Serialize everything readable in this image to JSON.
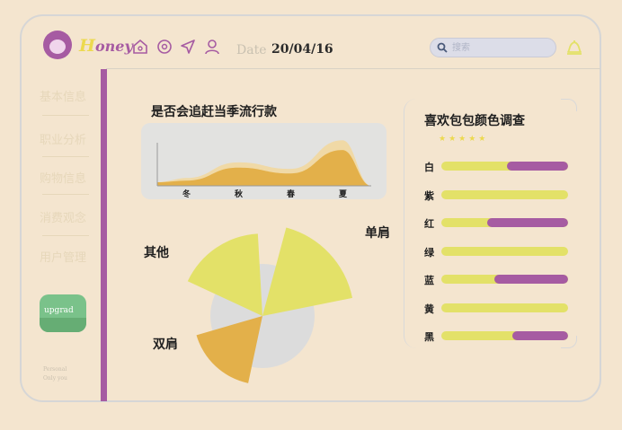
{
  "brand": {
    "first": "H",
    "rest": "oney"
  },
  "header": {
    "date_label": "Date",
    "date_value": "20/04/16",
    "search_placeholder": "搜索"
  },
  "sidebar": {
    "items": [
      {
        "label": "基本信息"
      },
      {
        "label": "职业分析"
      },
      {
        "label": "购物信息"
      },
      {
        "label": "消费观念"
      },
      {
        "label": "用户管理"
      }
    ],
    "upgrade_label": "upgrad",
    "footnote": [
      "Personal",
      "Only you"
    ]
  },
  "trend": {
    "title": "是否会追赶当季流行款",
    "chart_data": {
      "type": "area",
      "title": "是否会追赶当季流行款",
      "categories": [
        "冬",
        "秋",
        "春",
        "夏"
      ],
      "series": [
        {
          "values": [
            1.2,
            3.6,
            2.6,
            7.0
          ]
        },
        {
          "values": [
            0.8,
            2.8,
            1.9,
            5.5
          ]
        }
      ],
      "ylim": [
        0,
        8
      ],
      "colors": [
        "#f0d9a6",
        "#e3b04a"
      ]
    }
  },
  "bag_type": {
    "chart_data": {
      "type": "pie",
      "categories": [
        "单肩",
        "其他",
        "双肩"
      ],
      "values": [
        34,
        33,
        33
      ],
      "radius_share": [
        1.0,
        0.9,
        0.75
      ],
      "colors": [
        "#e3e168",
        "#e3e168",
        "#e3b04a"
      ],
      "base_color": "#dcdcdc"
    }
  },
  "color_survey": {
    "title": "喜欢包包颜色调查",
    "stars": "★★★★★",
    "chart_data": {
      "type": "bar",
      "categories": [
        "白",
        "紫",
        "红",
        "绿",
        "蓝",
        "黄",
        "黑"
      ],
      "values": [
        0.48,
        0.0,
        0.64,
        0.0,
        0.58,
        0.0,
        0.44
      ],
      "colors": {
        "track": "#e3e168",
        "fill": "#a65ba2"
      }
    }
  },
  "colors": {
    "accent": "#a65ba2",
    "yellow": "#e3e168",
    "gold": "#e3b04a",
    "background": "#f4e5cf"
  }
}
